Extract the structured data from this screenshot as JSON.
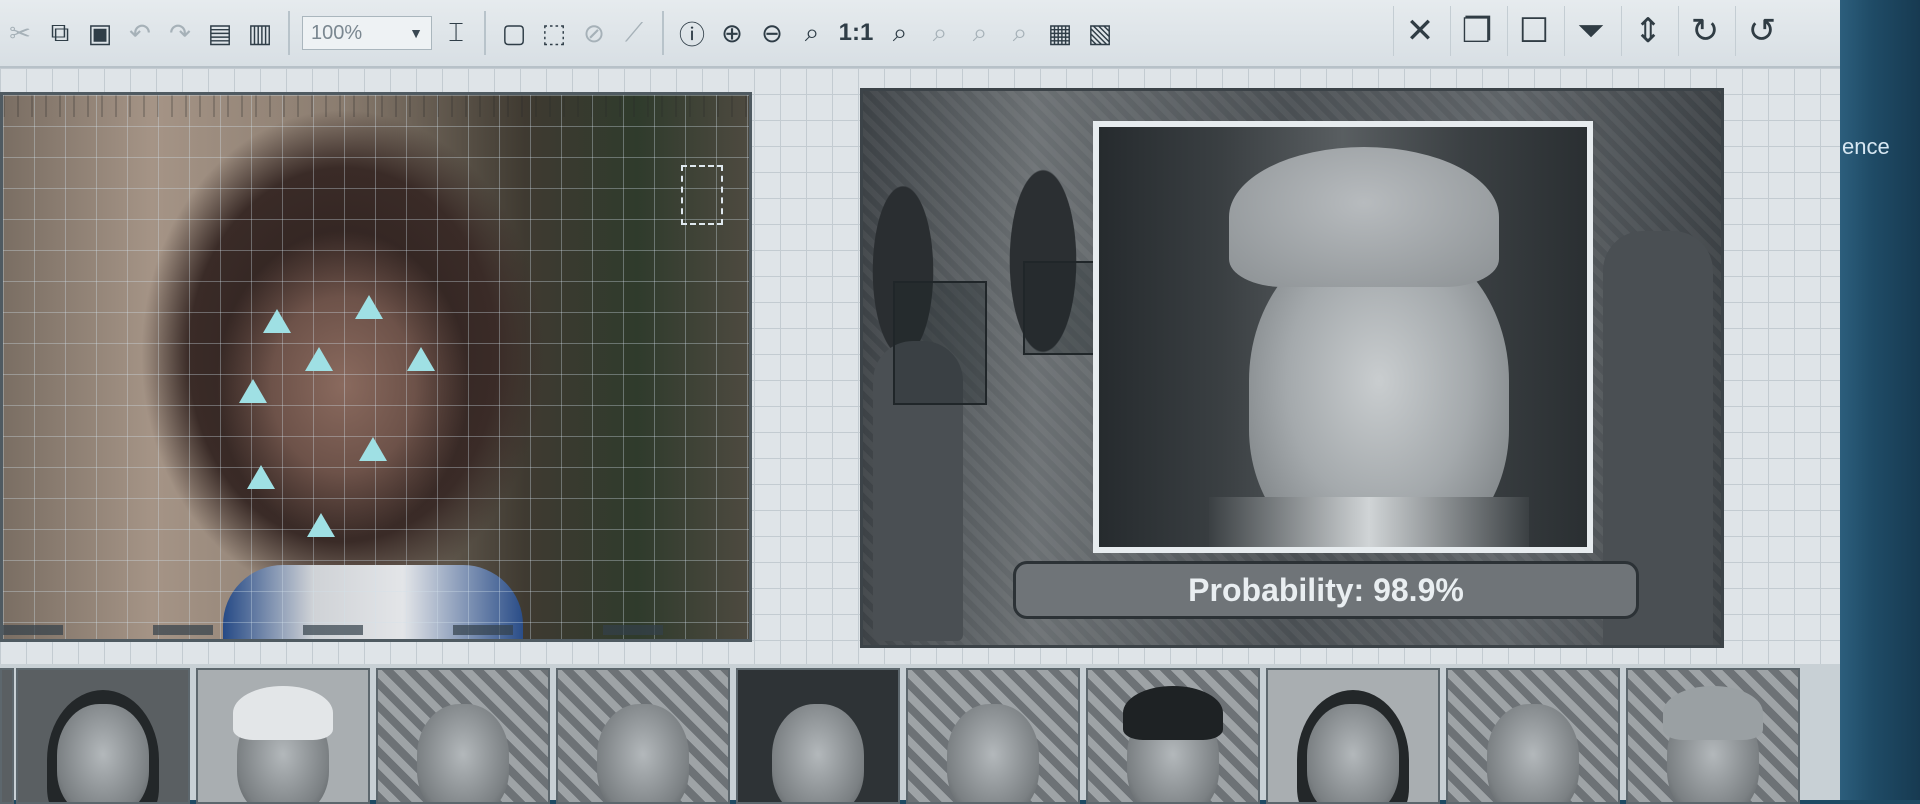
{
  "toolbar": {
    "zoom_value": "100%",
    "buttons_left": [
      "cut-icon",
      "copy-icon",
      "paste-icon",
      "undo-icon",
      "redo-icon",
      "save-icon",
      "export-icon"
    ],
    "one_to_one_label": "1:1"
  },
  "left_panel": {
    "landmarks": 8
  },
  "right_panel": {
    "probability_label": "Probability: 98.9%"
  },
  "sidebar_text": "ence",
  "thumbnails": [
    {
      "bg": "plain",
      "cap": ""
    },
    {
      "bg": "light",
      "cap": "#e3e6e8"
    },
    {
      "bg": "pattern",
      "cap": ""
    },
    {
      "bg": "pattern",
      "cap": ""
    },
    {
      "bg": "dark",
      "cap": ""
    },
    {
      "bg": "pattern",
      "cap": ""
    },
    {
      "bg": "pattern",
      "cap": "#1e2224"
    },
    {
      "bg": "light",
      "cap": ""
    },
    {
      "bg": "pattern",
      "cap": ""
    },
    {
      "bg": "pattern",
      "cap": "#9aa0a3"
    }
  ],
  "colors": {
    "landmark": "#9fe0e4",
    "toolbar_bg": "#dfe5e9",
    "bezel": "#1f4b66"
  }
}
